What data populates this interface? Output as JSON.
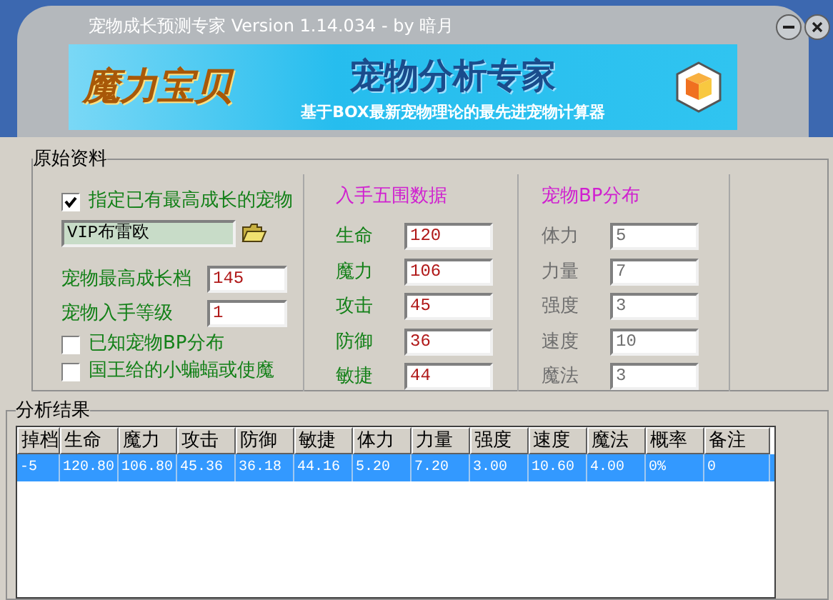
{
  "window": {
    "title": "宠物成长预测专家 Version 1.14.034 - by 暗月"
  },
  "banner": {
    "logo": "魔力宝贝",
    "heading": "宠物分析专家",
    "tagline": "基于BOX最新宠物理论的最先进宠物计算器"
  },
  "source": {
    "title": "原始资料",
    "specify_pet": {
      "label": "指定已有最高成长的宠物",
      "checked": true
    },
    "pet_name": "VIP布雷欧",
    "max_growth": {
      "label": "宠物最高成长档",
      "value": "145"
    },
    "start_level": {
      "label": "宠物入手等级",
      "value": "1"
    },
    "known_bp": {
      "label": "已知宠物BP分布",
      "checked": false
    },
    "king_pet": {
      "label": "国王给的小蝙蝠或使魔",
      "checked": false
    }
  },
  "base_stats": {
    "title": "入手五围数据",
    "disabled": false,
    "fields": [
      {
        "label": "生命",
        "value": "120"
      },
      {
        "label": "魔力",
        "value": "106"
      },
      {
        "label": "攻击",
        "value": "45"
      },
      {
        "label": "防御",
        "value": "36"
      },
      {
        "label": "敏捷",
        "value": "44"
      }
    ]
  },
  "bp": {
    "title": "宠物BP分布",
    "disabled": true,
    "fields": [
      {
        "label": "体力",
        "value": "5"
      },
      {
        "label": "力量",
        "value": "7"
      },
      {
        "label": "强度",
        "value": "3"
      },
      {
        "label": "速度",
        "value": "10"
      },
      {
        "label": "魔法",
        "value": "3"
      }
    ]
  },
  "results": {
    "title": "分析结果",
    "columns": [
      "掉档",
      "生命",
      "魔力",
      "攻击",
      "防御",
      "敏捷",
      "体力",
      "力量",
      "强度",
      "速度",
      "魔法",
      "概率",
      "备注"
    ],
    "rows": [
      {
        "selected": true,
        "cells": [
          "-5",
          "120.80",
          "106.80",
          "45.36",
          "36.18",
          "44.16",
          "5.20",
          "7.20",
          "3.00",
          "10.60",
          "4.00",
          "0%",
          "0"
        ]
      }
    ]
  }
}
